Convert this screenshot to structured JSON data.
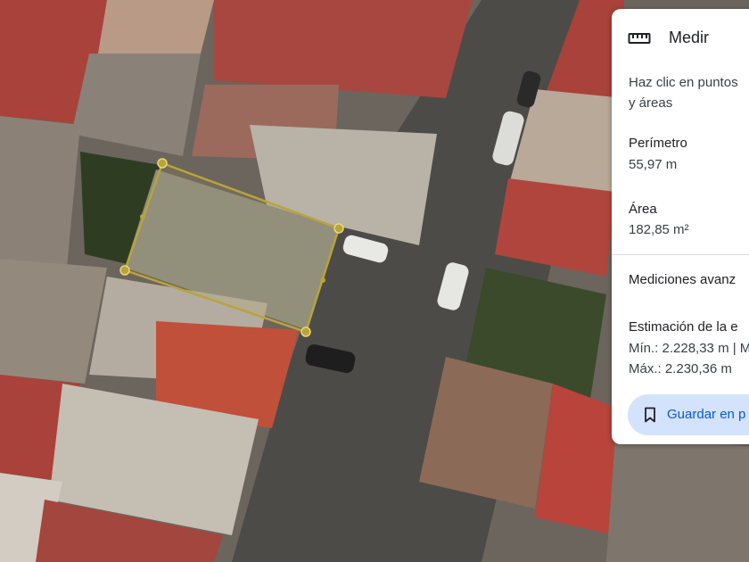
{
  "map": {
    "measurement_points": 6,
    "colors": {
      "measure_line": "#b8a43a",
      "road": "#4d4b47",
      "roof_red": "#a8423a",
      "roof_gray": "#b4aca0",
      "tree": "#2e3d22"
    }
  },
  "panel": {
    "icon": "ruler-icon",
    "title": "Medir",
    "hint_line1": "Haz clic en puntos",
    "hint_line2": "y áreas",
    "perimeter_label": "Perímetro",
    "perimeter_value": "55,97 m",
    "area_label": "Área",
    "area_value": "182,85 m²",
    "advanced_label": "Mediciones avanz",
    "estimate_label": "Estimación de la e",
    "min_value": "Mín.: 2.228,33 m | M",
    "max_value": "Máx.: 2.230,36 m",
    "save_icon": "bookmark-icon",
    "save_label": "Guardar en p",
    "colors": {
      "accent": "#0b57d0",
      "button_bg": "#d3e3fd"
    }
  }
}
